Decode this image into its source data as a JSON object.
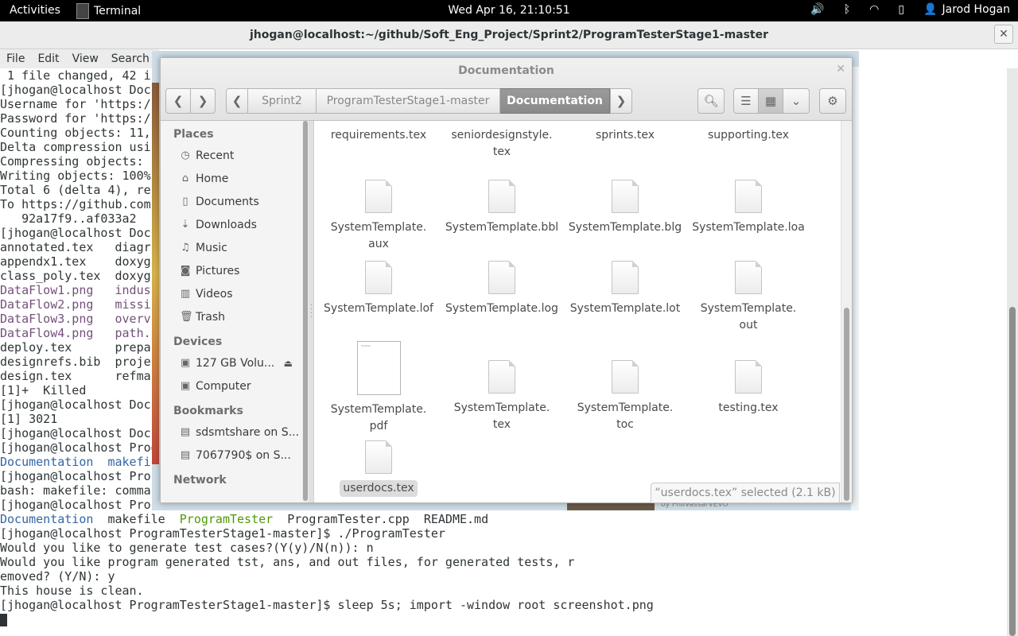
{
  "topbar": {
    "activities": "Activities",
    "app_name": "Terminal",
    "clock": "Wed Apr 16, 21:10:51",
    "user": "Jarod Hogan",
    "icons": [
      "volume-icon",
      "bluetooth-icon",
      "wifi-icon",
      "battery-icon",
      "user-icon"
    ]
  },
  "terminal": {
    "title": "jhogan@localhost:~/github/Soft_Eng_Project/Sprint2/ProgramTesterStage1-master",
    "menu": [
      "File",
      "Edit",
      "View",
      "Search"
    ],
    "lines": [
      " 1 file changed, 42 i",
      "[jhogan@localhost Doc",
      "Username for 'https:/",
      "Password for 'https:/",
      "Counting objects: 11,",
      "Delta compression usi",
      "Compressing objects: ",
      "Writing objects: 100%",
      "Total 6 (delta 4), re",
      "To https://github.com",
      "   92a17f9..af033a2  ",
      "[jhogan@localhost Doc",
      "annotated.tex   diagr",
      "appendx1.tex    doxyg",
      "class_poly.tex  doxyg",
      "DataFlow1.png   indus",
      "DataFlow2.png   missi",
      "DataFlow3.png   overv",
      "DataFlow4.png   path.",
      "deploy.tex      prepa",
      "designrefs.bib  proje",
      "design.tex      refma",
      "[1]+  Killed",
      "[jhogan@localhost Doc",
      "[1] 3021",
      "[jhogan@localhost Doc",
      "[jhogan@localhost Prog",
      "Documentation  makefi",
      "[jhogan@localhost Pro",
      "bash: makefile: comma",
      "[jhogan@localhost Pro"
    ],
    "ls_line": {
      "a": "Documentation",
      "b": "  makefile  ",
      "c": "ProgramTester",
      "d": "  ProgramTester.cpp  README.md"
    },
    "tail": [
      "[jhogan@localhost ProgramTesterStage1-master]$ ./ProgramTester",
      "Would you like to generate test cases?(Y(y)/N(n)): n",
      "Would you like program generated tst, ans, and out files, for generated tests, r",
      "emoved? (Y/N): y",
      "This house is clean.",
      "[jhogan@localhost ProgramTesterStage1-master]$ sleep 5s; import -window root screenshot.png"
    ]
  },
  "files": {
    "title": "Documentation",
    "breadcrumbs": [
      "Sprint2",
      "ProgramTesterStage1-master",
      "Documentation"
    ],
    "sidebar": {
      "places_label": "Places",
      "places": [
        {
          "label": "Recent",
          "icon": "clock-icon"
        },
        {
          "label": "Home",
          "icon": "home-icon"
        },
        {
          "label": "Documents",
          "icon": "document-icon"
        },
        {
          "label": "Downloads",
          "icon": "download-icon"
        },
        {
          "label": "Music",
          "icon": "music-icon"
        },
        {
          "label": "Pictures",
          "icon": "camera-icon"
        },
        {
          "label": "Videos",
          "icon": "film-icon"
        },
        {
          "label": "Trash",
          "icon": "trash-icon"
        }
      ],
      "devices_label": "Devices",
      "devices": [
        {
          "label": "127 GB Volu...",
          "icon": "drive-icon"
        },
        {
          "label": "Computer",
          "icon": "drive-icon"
        }
      ],
      "bookmarks_label": "Bookmarks",
      "bookmarks": [
        {
          "label": "sdsmtshare on S...",
          "icon": "network-folder-icon"
        },
        {
          "label": "7067790$ on S...",
          "icon": "network-folder-icon"
        }
      ],
      "network_label": "Network"
    },
    "items": [
      {
        "l1": "requirements.tex",
        "l2": ""
      },
      {
        "l1": "seniordesignstyle.",
        "l2": "tex"
      },
      {
        "l1": "sprints.tex",
        "l2": ""
      },
      {
        "l1": "supporting.tex",
        "l2": ""
      },
      {
        "l1": "SystemTemplate.",
        "l2": "aux"
      },
      {
        "l1": "SystemTemplate.bbl",
        "l2": ""
      },
      {
        "l1": "SystemTemplate.blg",
        "l2": ""
      },
      {
        "l1": "SystemTemplate.loa",
        "l2": ""
      },
      {
        "l1": "SystemTemplate.lof",
        "l2": ""
      },
      {
        "l1": "SystemTemplate.log",
        "l2": ""
      },
      {
        "l1": "SystemTemplate.lot",
        "l2": ""
      },
      {
        "l1": "SystemTemplate.",
        "l2": "out"
      },
      {
        "l1": "SystemTemplate.",
        "l2": "pdf"
      },
      {
        "l1": "SystemTemplate.",
        "l2": "tex"
      },
      {
        "l1": "SystemTemplate.",
        "l2": "toc"
      },
      {
        "l1": "testing.tex",
        "l2": ""
      },
      {
        "l1": "userdocs.tex",
        "l2": ""
      }
    ],
    "status": "“userdocs.tex” selected  (2.1 kB)"
  },
  "background": {
    "credit": "by PhilVassarVEVO"
  }
}
